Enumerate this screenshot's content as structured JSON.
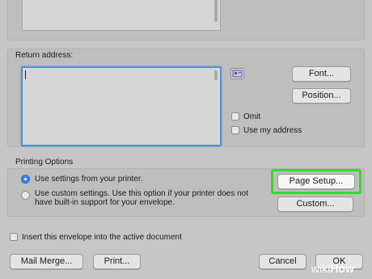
{
  "return_address": {
    "label": "Return address:",
    "font_button": "Font...",
    "position_button": "Position...",
    "omit_label": "Omit",
    "use_my_address_label": "Use my address"
  },
  "printing_options": {
    "label": "Printing Options",
    "option_printer": "Use settings from your printer.",
    "option_custom_line1": "Use custom settings. Use this option if your printer does not",
    "option_custom_line2": "have built-in support for your envelope.",
    "page_setup_button": "Page Setup...",
    "custom_button": "Custom..."
  },
  "insert_label": "Insert this envelope into the active document",
  "footer": {
    "mail_merge_button": "Mail Merge...",
    "print_button": "Print...",
    "cancel_button": "Cancel",
    "ok_button": "OK"
  },
  "watermark": {
    "brand": "wiki",
    "suffix": "How"
  },
  "colors": {
    "highlight": "#37d82e",
    "focus": "#4f8fd4",
    "radio_selected": "#3b86e0"
  }
}
